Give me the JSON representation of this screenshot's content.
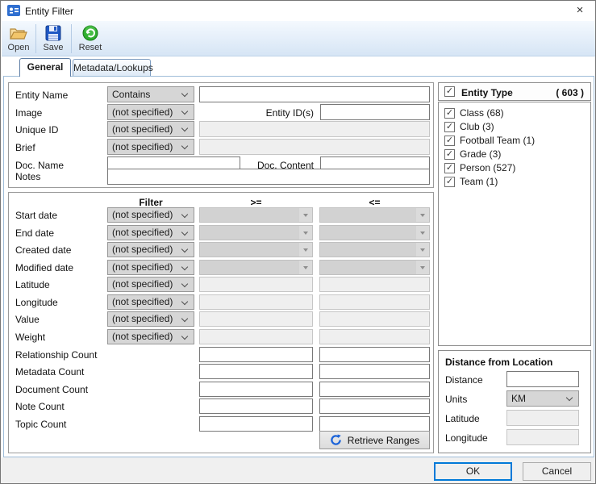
{
  "window": {
    "title": "Entity Filter",
    "close_glyph": "×"
  },
  "toolbar": {
    "buttons": [
      {
        "label": "Open",
        "icon": "open-folder-icon"
      },
      {
        "label": "Save",
        "icon": "save-floppy-icon"
      },
      {
        "label": "Reset",
        "icon": "reset-green-icon"
      }
    ]
  },
  "tabs": {
    "general": "General",
    "metadata": "Metadata/Lookups"
  },
  "general_tab": {
    "top": {
      "entity_name": {
        "label": "Entity Name",
        "op": "Contains",
        "value": ""
      },
      "image": {
        "label": "Image",
        "op": "(not specified)",
        "entity_ids_label": "Entity ID(s)",
        "entity_ids_value": ""
      },
      "unique_id": {
        "label": "Unique ID",
        "op": "(not specified)"
      },
      "brief": {
        "label": "Brief",
        "op": "(not specified)"
      },
      "doc_name": {
        "label": "Doc. Name",
        "value": "",
        "doc_content_label": "Doc. Content",
        "doc_content_value": ""
      },
      "notes": {
        "label": "Notes",
        "value": ""
      }
    },
    "filter_table": {
      "headers": {
        "filter": "Filter",
        "gte": ">=",
        "lte": "<="
      },
      "rows": [
        {
          "label": "Start date",
          "type": "date",
          "op": "(not specified)"
        },
        {
          "label": "End date",
          "type": "date",
          "op": "(not specified)"
        },
        {
          "label": "Created date",
          "type": "date",
          "op": "(not specified)"
        },
        {
          "label": "Modified date",
          "type": "date",
          "op": "(not specified)"
        },
        {
          "label": "Latitude",
          "type": "numeric",
          "op": "(not specified)"
        },
        {
          "label": "Longitude",
          "type": "numeric",
          "op": "(not specified)"
        },
        {
          "label": "Value",
          "type": "numeric",
          "op": "(not specified)"
        },
        {
          "label": "Weight",
          "type": "numeric",
          "op": "(not specified)"
        },
        {
          "label": "Relationship Count",
          "type": "count",
          "gte_value": "",
          "lte_value": ""
        },
        {
          "label": "Metadata Count",
          "type": "count",
          "gte_value": "",
          "lte_value": ""
        },
        {
          "label": "Document Count",
          "type": "count",
          "gte_value": "",
          "lte_value": ""
        },
        {
          "label": "Note Count",
          "type": "count",
          "gte_value": "",
          "lte_value": ""
        },
        {
          "label": "Topic Count",
          "type": "count",
          "gte_value": "",
          "lte_value": ""
        }
      ],
      "retrieve_label": "Retrieve Ranges"
    }
  },
  "entity_type": {
    "header_label": "Entity Type",
    "header_count": "( 603 )",
    "header_checked": true,
    "check_glyph": "✓",
    "items": [
      {
        "label": "Class (68)",
        "checked": true
      },
      {
        "label": "Club (3)",
        "checked": true
      },
      {
        "label": "Football Team (1)",
        "checked": true
      },
      {
        "label": "Grade (3)",
        "checked": true
      },
      {
        "label": "Person (527)",
        "checked": true
      },
      {
        "label": "Team (1)",
        "checked": true
      }
    ]
  },
  "distance_panel": {
    "title": "Distance from Location",
    "distance": {
      "label": "Distance",
      "value": ""
    },
    "units": {
      "label": "Units",
      "value": "KM"
    },
    "latitude": {
      "label": "Latitude",
      "value": ""
    },
    "longitude": {
      "label": "Longitude",
      "value": ""
    }
  },
  "footer": {
    "ok": "OK",
    "cancel": "Cancel"
  },
  "colors": {
    "toolbar_top": "#f4f9fe",
    "toolbar_bottom": "#d6e5f5",
    "content_border": "#9ebcd8",
    "accent_blue": "#0079d8",
    "combo_gray": "#d6d6d6",
    "disabled_gray": "#efefef",
    "reset_green": "#2fae2f",
    "save_blue": "#1f58c4",
    "folder_tan": "#f2c56b"
  }
}
